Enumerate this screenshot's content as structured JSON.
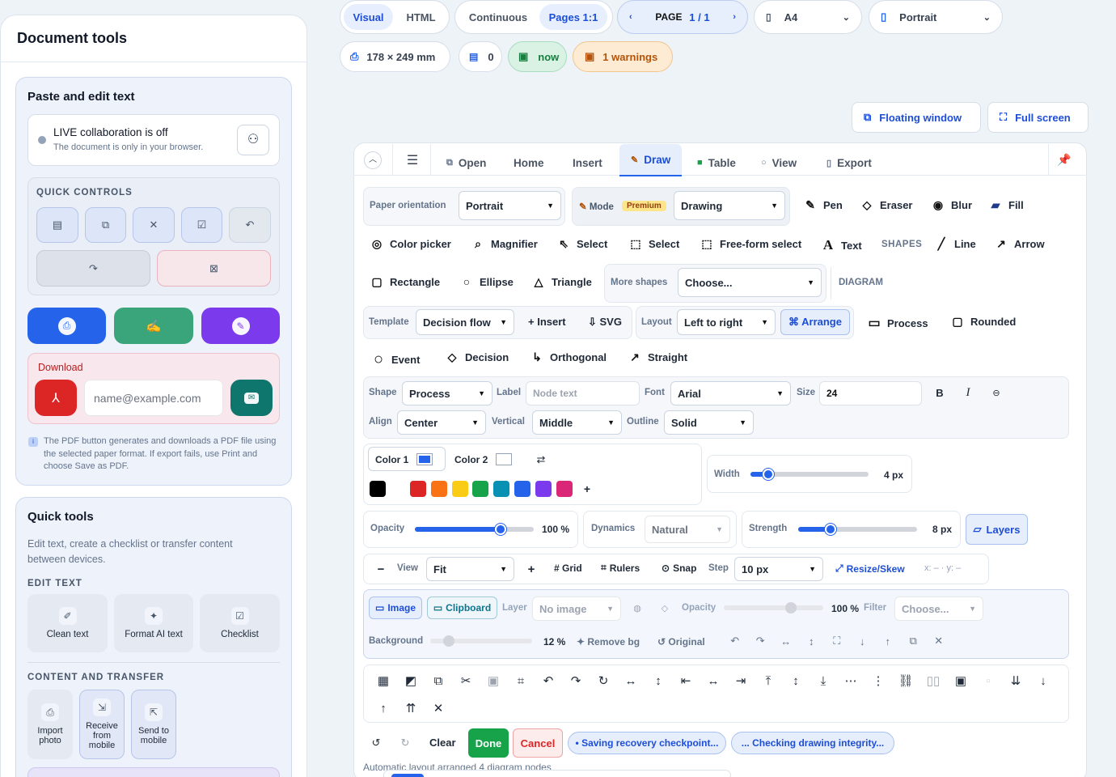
{
  "sidebar": {
    "title": "Document tools",
    "paste": {
      "title": "Paste and edit text",
      "live_title": "LIVE collaboration is off",
      "live_sub": "The document is only in your browser."
    },
    "quick_controls": {
      "label": "QUICK CONTROLS"
    },
    "download": {
      "label": "Download",
      "email_placeholder": "name@example.com",
      "note": "The PDF button generates and downloads a PDF file using the selected paper format. If export fails, use Print and choose Save as PDF."
    },
    "quick_tools": {
      "title": "Quick tools",
      "desc": "Edit text, create a checklist or transfer content between devices.",
      "edit_label": "EDIT TEXT",
      "edit_items": [
        "Clean text",
        "Format AI text",
        "Checklist"
      ],
      "transfer_label": "CONTENT AND TRANSFER",
      "transfer_items": [
        "Import photo",
        "Receive from mobile",
        "Send to mobile"
      ]
    }
  },
  "top": {
    "view_tabs": [
      "Visual",
      "HTML"
    ],
    "page_tabs": [
      "Continuous",
      "Pages 1:1"
    ],
    "page_label": "PAGE",
    "page_value": "1 / 1",
    "paper": "A4",
    "orientation": "Portrait",
    "dims": "178 × 249 mm",
    "count": "0",
    "saved": "now",
    "warnings": "1 warnings",
    "floating": "Floating window",
    "fullscreen": "Full screen"
  },
  "editor": {
    "tabs": [
      "Open",
      "Home",
      "Insert",
      "Draw",
      "Table",
      "View",
      "Export"
    ],
    "row1": {
      "paper_label": "Paper orientation",
      "paper_value": "Portrait",
      "mode_label": "Mode",
      "premium": "Premium",
      "mode_value": "Drawing",
      "tools": [
        "Pen",
        "Eraser",
        "Blur",
        "Fill"
      ]
    },
    "row2": {
      "tools": [
        "Color picker",
        "Magnifier",
        "Select",
        "Select",
        "Free-form select",
        "Text"
      ],
      "shapes_label": "SHAPES",
      "shape_tools": [
        "Line",
        "Arrow"
      ]
    },
    "row3": {
      "tools": [
        "Rectangle",
        "Ellipse",
        "Triangle"
      ],
      "more_label": "More shapes",
      "more_value": "Choose...",
      "diagram_label": "DIAGRAM"
    },
    "row4": {
      "template_label": "Template",
      "template_value": "Decision flow",
      "insert": "+ Insert",
      "svg": "⇩ SVG",
      "layout_label": "Layout",
      "layout_value": "Left to right",
      "arrange": "⌘ Arrange",
      "process": "Process",
      "rounded": "Rounded"
    },
    "row5": {
      "tools": [
        "Event",
        "Decision",
        "Orthogonal",
        "Straight"
      ]
    },
    "props": {
      "shape_label": "Shape",
      "shape_value": "Process",
      "label_label": "Label",
      "label_placeholder": "Node text",
      "font_label": "Font",
      "font_value": "Arial",
      "size_label": "Size",
      "size_value": "24",
      "align_label": "Align",
      "align_value": "Center",
      "vertical_label": "Vertical",
      "vertical_value": "Middle",
      "outline_label": "Outline",
      "outline_value": "Solid"
    },
    "colors": {
      "color1": "Color 1",
      "color2": "Color 2",
      "swatches": [
        "#000000",
        "#dc2626",
        "#f97316",
        "#facc15",
        "#16a34a",
        "#0891b2",
        "#2563eb",
        "#7c3aed",
        "#db2777"
      ]
    },
    "width": {
      "label": "Width",
      "value": "4 px",
      "fraction": 0.15
    },
    "opacity": {
      "label": "Opacity",
      "value": "100 %",
      "fraction": 0.72
    },
    "dynamics": {
      "label": "Dynamics",
      "value": "Natural"
    },
    "strength": {
      "label": "Strength",
      "value": "8 px",
      "fraction": 0.27
    },
    "layers": "Layers",
    "view": {
      "label": "View",
      "value": "Fit",
      "grid": "# Grid",
      "rulers": "Rulers",
      "snap": "Snap",
      "step_label": "Step",
      "step_value": "10 px",
      "resize": "Resize/Skew",
      "coords": "x: – · y: –"
    },
    "image": {
      "image_btn": "Image",
      "clipboard_btn": "Clipboard",
      "layer_label": "Layer",
      "layer_value": "No image",
      "opacity_label": "Opacity",
      "opacity_value": "100 %",
      "filter_label": "Filter",
      "filter_value": "Choose...",
      "bg_label": "Background",
      "bg_value": "12 %",
      "remove_bg": "✦ Remove bg",
      "original": "↺ Original"
    },
    "actions": {
      "clear": "Clear",
      "done": "Done",
      "cancel": "Cancel",
      "status1": "• Saving recovery checkpoint...",
      "status2": "... Checking drawing integrity..."
    },
    "footer_note": "Automatic layout arranged 4 diagram nodes"
  }
}
